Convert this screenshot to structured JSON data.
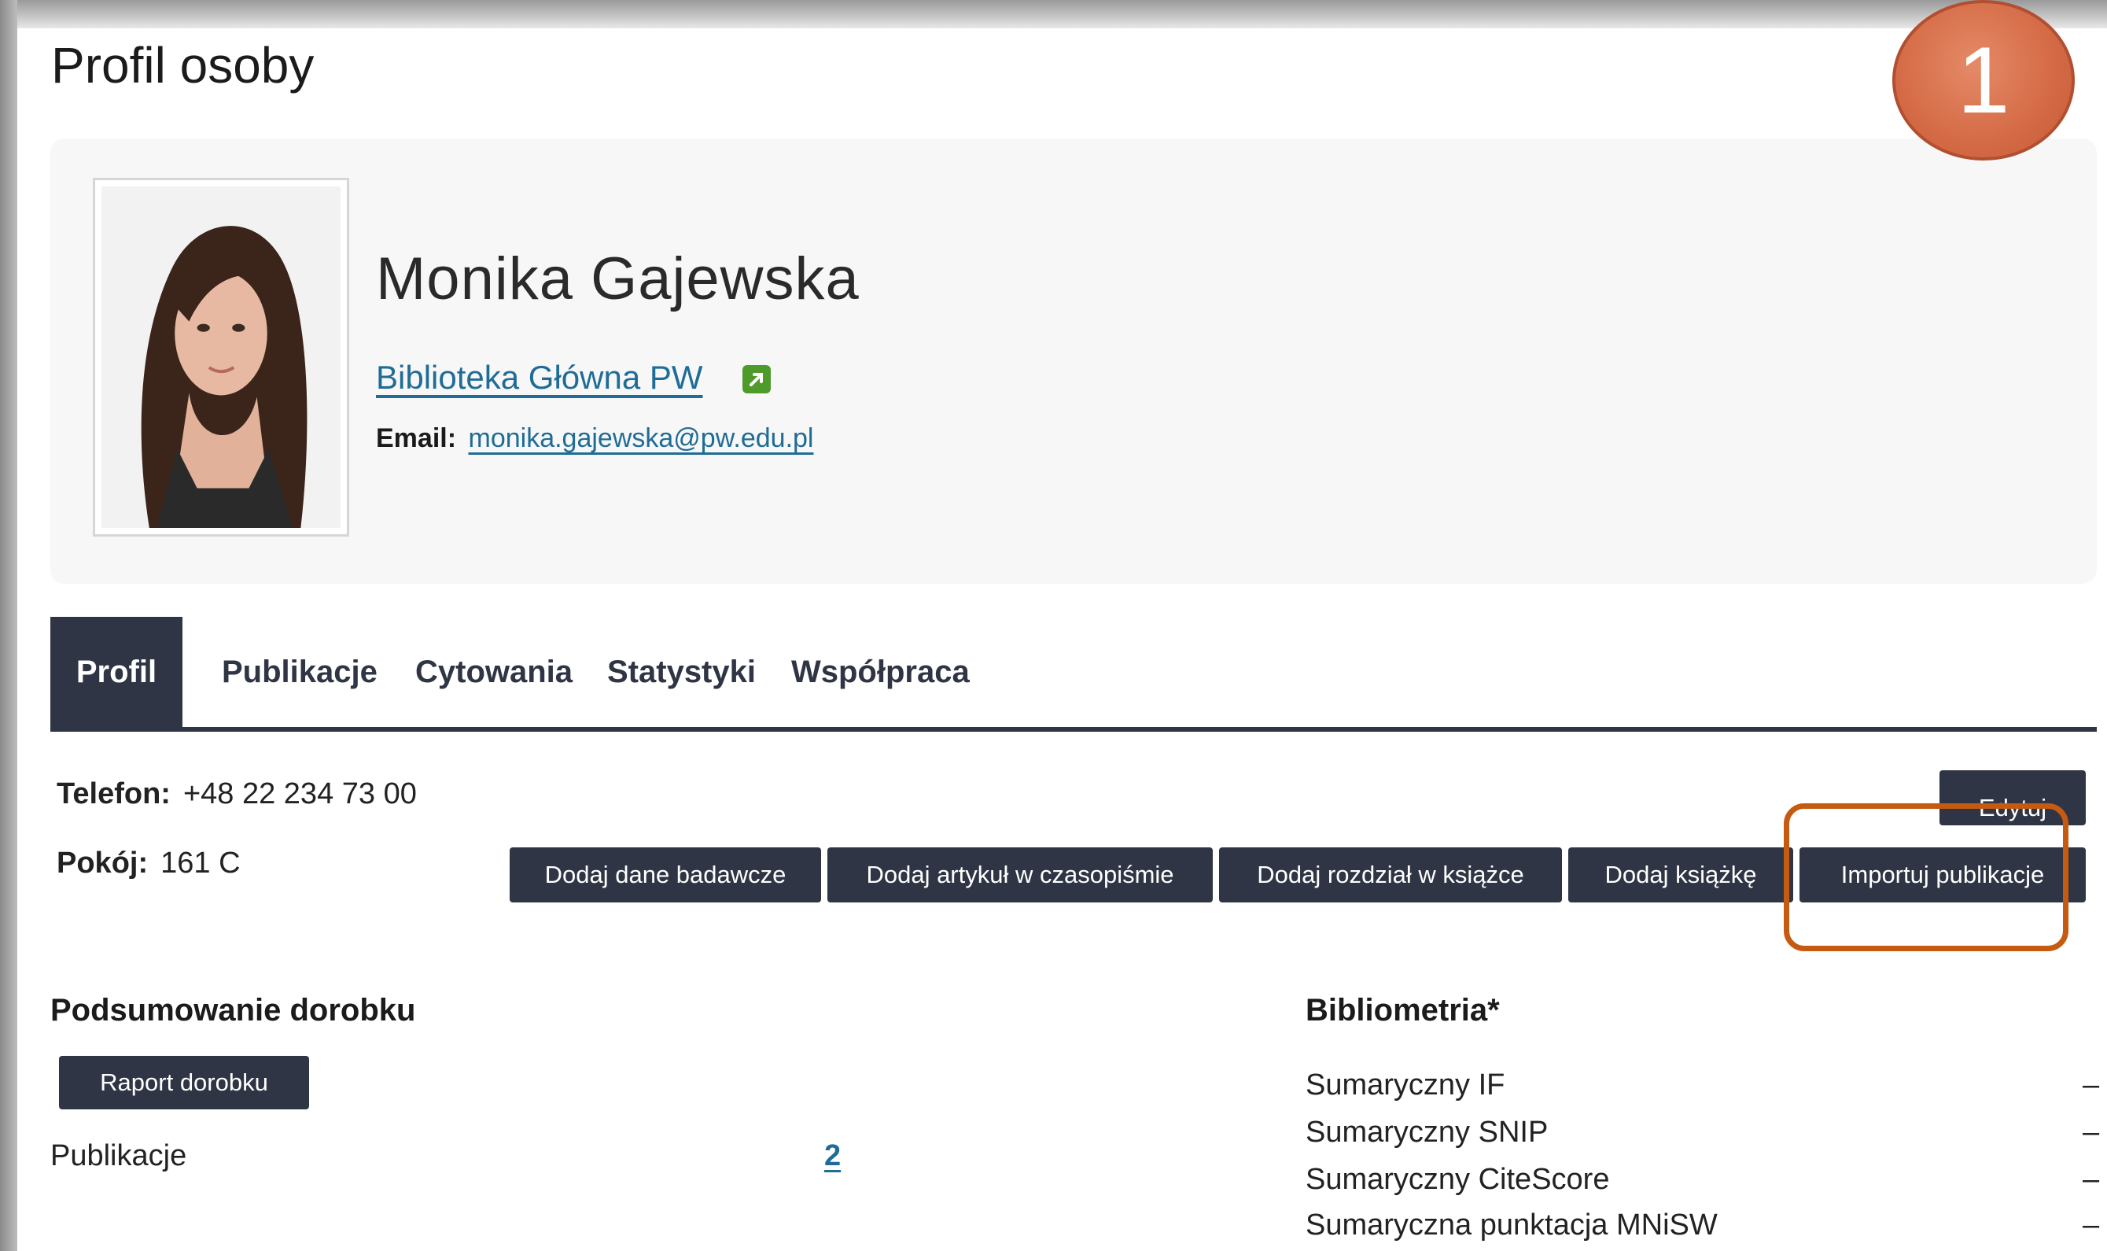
{
  "page": {
    "title": "Profil osoby"
  },
  "step_badge": "1",
  "profile": {
    "name": "Monika Gajewska",
    "unit": "Biblioteka Główna PW",
    "email_label": "Email:",
    "email": "monika.gajewska@pw.edu.pl"
  },
  "tabs": [
    {
      "label": "Profil",
      "active": true
    },
    {
      "label": "Publikacje",
      "active": false
    },
    {
      "label": "Cytowania",
      "active": false
    },
    {
      "label": "Statystyki",
      "active": false
    },
    {
      "label": "Współpraca",
      "active": false
    }
  ],
  "contact": {
    "phone_label": "Telefon:",
    "phone": "+48 22 234 73 00",
    "room_label": "Pokój:",
    "room": "161 C"
  },
  "actions": {
    "edit": "Edytuj",
    "add_research_data": "Dodaj dane badawcze",
    "add_article": "Dodaj artykuł w czasopiśmie",
    "add_chapter": "Dodaj rozdział w książce",
    "add_book": "Dodaj książkę",
    "import_publications": "Importuj publikacje"
  },
  "summary": {
    "title": "Podsumowanie dorobku",
    "report_button": "Raport dorobku",
    "publications_label": "Publikacje",
    "publications_count": "2"
  },
  "bibliometrics": {
    "title": "Bibliometria*",
    "rows": [
      {
        "label": "Sumaryczny IF",
        "value": "–"
      },
      {
        "label": "Sumaryczny SNIP",
        "value": "–"
      },
      {
        "label": "Sumaryczny CiteScore",
        "value": "–"
      },
      {
        "label": "Sumaryczna punktacja MNiSW",
        "value": "–"
      }
    ]
  },
  "colors": {
    "dark_button": "#2f3544",
    "link": "#1f6c96",
    "highlight": "#c55a11",
    "badge": "#d46a45"
  }
}
